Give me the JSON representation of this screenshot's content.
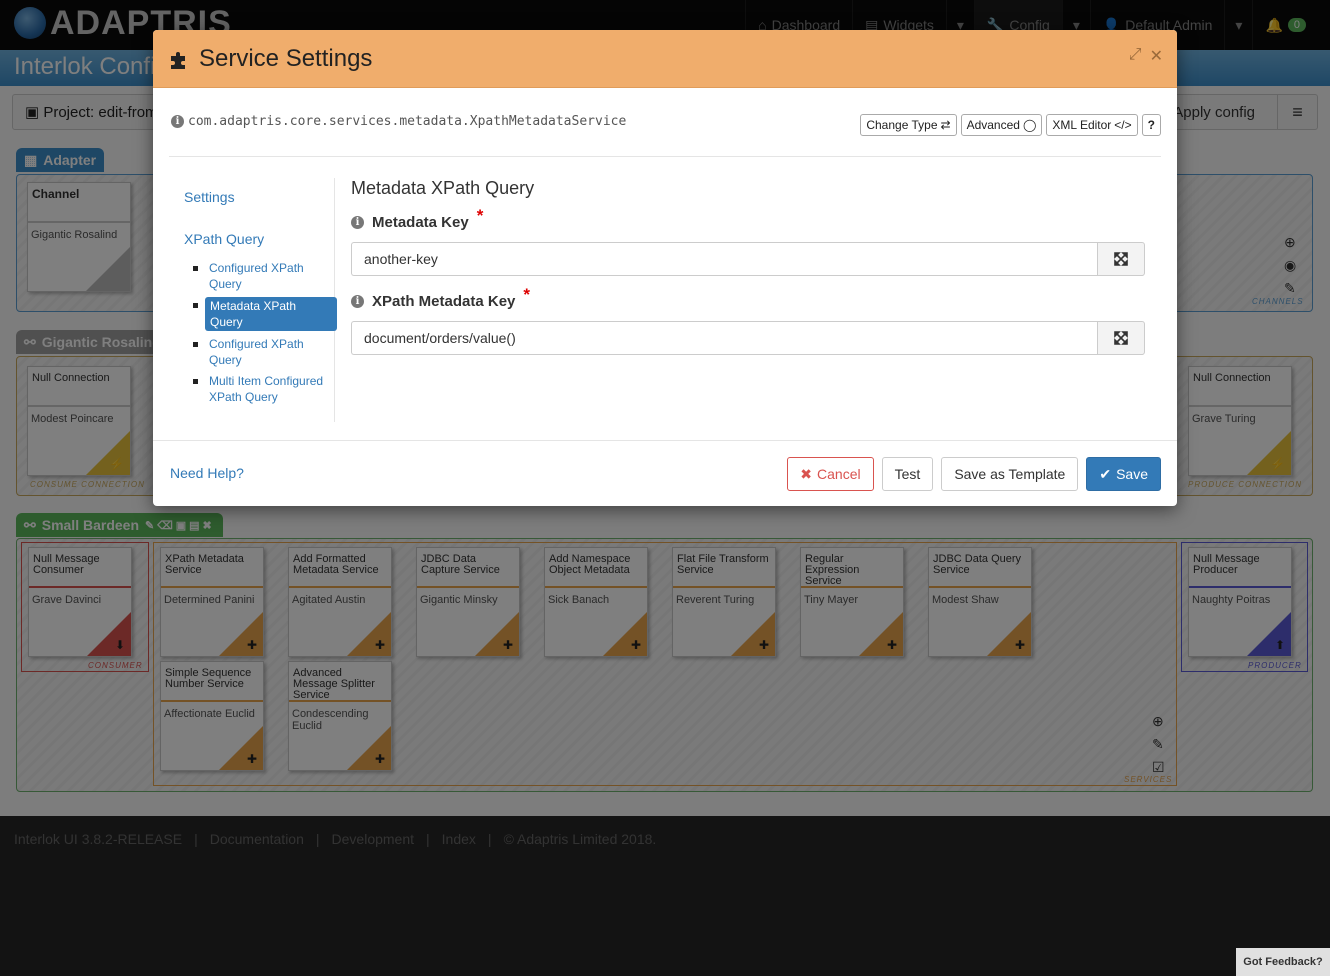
{
  "navbar": {
    "brand": "ADAPTRIS",
    "items": [
      {
        "label": "Dashboard",
        "icon": "dashboard-icon"
      },
      {
        "label": "Widgets",
        "icon": "widgets-icon"
      },
      {
        "label": "Config",
        "icon": "wrench-icon"
      },
      {
        "label": "Default Admin",
        "icon": "user-icon"
      }
    ],
    "notification_count": "0"
  },
  "page": {
    "title": "Interlok Config",
    "project_label": "Project: edit-from-",
    "apply_label": "Apply config",
    "adapter_tab": "Adapter",
    "channel_card": {
      "title": "Channel",
      "name": "Gigantic Rosalind"
    },
    "channels_label": "CHANNELS",
    "workflow_tab": "Gigantic Rosalind",
    "consume_conn": {
      "title": "Null Connection",
      "name": "Modest Poincare",
      "label": "CONSUME CONNECTION"
    },
    "produce_conn": {
      "title": "Null Connection",
      "name": "Grave Turing",
      "label": "PRODUCE CONNECTION"
    },
    "small_tab": "Small Bardeen",
    "consumer": {
      "title": "Null Message Consumer",
      "name": "Grave Davinci",
      "label": "CONSUMER"
    },
    "producer": {
      "title": "Null Message Producer",
      "name": "Naughty Poitras",
      "label": "PRODUCER"
    },
    "services_label": "SERVICES",
    "services": [
      {
        "title": "XPath Metadata Service",
        "name": "Determined Panini"
      },
      {
        "title": "Add Formatted Metadata Service",
        "name": "Agitated Austin"
      },
      {
        "title": "JDBC Data Capture Service",
        "name": "Gigantic Minsky"
      },
      {
        "title": "Add Namespace Object Metadata",
        "name": "Sick Banach"
      },
      {
        "title": "Flat File Transform Service",
        "name": "Reverent Turing"
      },
      {
        "title": "Regular Expression Service",
        "name": "Tiny Mayer"
      },
      {
        "title": "JDBC Data Query Service",
        "name": "Modest Shaw"
      },
      {
        "title": "Simple Sequence Number Service",
        "name": "Affectionate Euclid"
      },
      {
        "title": "Advanced Message Splitter Service",
        "name": "Condescending Euclid"
      }
    ]
  },
  "footer": {
    "links": [
      "Interlok UI  3.8.2-RELEASE",
      "|",
      "Documentation",
      "|",
      "Development",
      "|",
      "Index",
      "|",
      "© Adaptris Limited 2018."
    ],
    "feedback": "Got Feedback?"
  },
  "modal": {
    "title": "Service Settings",
    "classname": "com.adaptris.core.services.metadata.XpathMetadataService",
    "buttons": {
      "change_type": "Change Type",
      "advanced": "Advanced",
      "xml_editor": "XML Editor",
      "help": "?"
    },
    "sidenav": {
      "settings": "Settings",
      "xpath_query": "XPath Query",
      "items": [
        "Configured XPath Query",
        "Metadata XPath Query",
        "Configured XPath Query",
        "Multi Item Configured XPath Query"
      ]
    },
    "form": {
      "title": "Metadata XPath Query",
      "metadata_key_label": "Metadata Key",
      "metadata_key_value": "another-key",
      "xpath_key_label": "XPath Metadata Key",
      "xpath_key_value": "document/orders/value()"
    },
    "footer": {
      "need_help": "Need Help?",
      "cancel": "Cancel",
      "test": "Test",
      "save_template": "Save as Template",
      "save": "Save"
    }
  }
}
